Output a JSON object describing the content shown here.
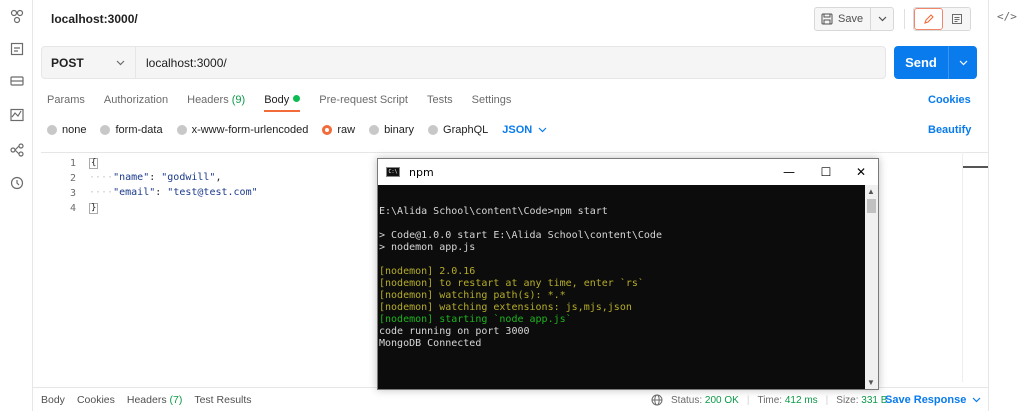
{
  "request": {
    "title": "localhost:3000/",
    "save_label": "Save",
    "method": "POST",
    "url": "localhost:3000/",
    "send_label": "Send"
  },
  "tabs": [
    {
      "label": "Params"
    },
    {
      "label": "Authorization"
    },
    {
      "label": "Headers",
      "count": "(9)"
    },
    {
      "label": "Body"
    },
    {
      "label": "Pre-request Script"
    },
    {
      "label": "Tests"
    },
    {
      "label": "Settings"
    }
  ],
  "cookies_label": "Cookies",
  "body_types": [
    {
      "label": "none"
    },
    {
      "label": "form-data"
    },
    {
      "label": "x-www-form-urlencoded"
    },
    {
      "label": "raw",
      "selected": true
    },
    {
      "label": "binary"
    },
    {
      "label": "GraphQL"
    }
  ],
  "format_label": "JSON",
  "beautify_label": "Beautify",
  "editor": {
    "line_numbers": [
      "1",
      "2",
      "3",
      "4"
    ],
    "open_brace": "{",
    "close_brace": "}",
    "line2_key": "\"name\"",
    "line2_value": "\"godwill\"",
    "line3_key": "\"email\"",
    "line3_value": "\"test@test.com\""
  },
  "console": {
    "title": "npm",
    "minimize": "—",
    "maximize": "☐",
    "close": "✕",
    "lines": [
      {
        "text": "",
        "color": "w"
      },
      {
        "text": "E:\\Alida School\\content\\Code>npm start",
        "color": "w"
      },
      {
        "text": "",
        "color": "w"
      },
      {
        "text": "> Code@1.0.0 start E:\\Alida School\\content\\Code",
        "color": "w"
      },
      {
        "text": "> nodemon app.js",
        "color": "w"
      },
      {
        "text": "",
        "color": "w"
      },
      {
        "text": "[nodemon] 2.0.16",
        "color": "y"
      },
      {
        "text": "[nodemon] to restart at any time, enter `rs`",
        "color": "y"
      },
      {
        "text": "[nodemon] watching path(s): *.*",
        "color": "y"
      },
      {
        "text": "[nodemon] watching extensions: js,mjs,json",
        "color": "y"
      },
      {
        "text": "[nodemon] starting `node app.js`",
        "color": "g"
      },
      {
        "text": "code running on port 3000",
        "color": "w"
      },
      {
        "text": "MongoDB Connected",
        "color": "w"
      }
    ]
  },
  "response_tabs": [
    {
      "label": "Body"
    },
    {
      "label": "Cookies"
    },
    {
      "label": "Headers",
      "count": "(7)"
    },
    {
      "label": "Test Results"
    }
  ],
  "response_status": {
    "status_label": "Status:",
    "status_value": "200 OK",
    "time_label": "Time:",
    "time_value": "412 ms",
    "size_label": "Size:",
    "size_value": "331 B"
  },
  "save_response_label": "Save Response",
  "colors": {
    "accent": "#097bed",
    "active_tab_underline": "#f26b3a",
    "body_dot": "#0cbb52",
    "status_ok": "#0c9a47"
  }
}
